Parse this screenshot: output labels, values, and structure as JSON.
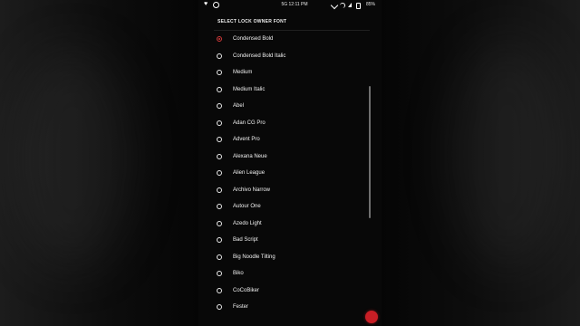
{
  "status_bar": {
    "time": "12:11 PM",
    "network_label": "5G",
    "battery_percent": "85%"
  },
  "dialog": {
    "title": "SELECT LOCK OWNER FONT",
    "options": [
      {
        "label": "Condensed Bold",
        "selected": true
      },
      {
        "label": "Condensed Bold Italic",
        "selected": false
      },
      {
        "label": "Medium",
        "selected": false
      },
      {
        "label": "Medium Italic",
        "selected": false
      },
      {
        "label": "Abel",
        "selected": false
      },
      {
        "label": "Adan CG Pro",
        "selected": false
      },
      {
        "label": "Advent Pro",
        "selected": false
      },
      {
        "label": "Alexana Neue",
        "selected": false
      },
      {
        "label": "Alien League",
        "selected": false
      },
      {
        "label": "Archivo Narrow",
        "selected": false
      },
      {
        "label": "Autour One",
        "selected": false
      },
      {
        "label": "Azedo Light",
        "selected": false
      },
      {
        "label": "Bad Script",
        "selected": false
      },
      {
        "label": "Big Noodle Tilting",
        "selected": false
      },
      {
        "label": "Biko",
        "selected": false
      },
      {
        "label": "CoCoBiker",
        "selected": false
      },
      {
        "label": "Fester",
        "selected": false
      }
    ]
  },
  "colors": {
    "selected_radio": "#d33a3a",
    "background": "#080808",
    "fab_red": "#c81e25"
  },
  "icons": {
    "status_left": [
      "heart-icon",
      "circle-icon"
    ],
    "status_right": [
      "signal-icon",
      "wifi-icon",
      "network-icon",
      "battery-icon"
    ]
  }
}
